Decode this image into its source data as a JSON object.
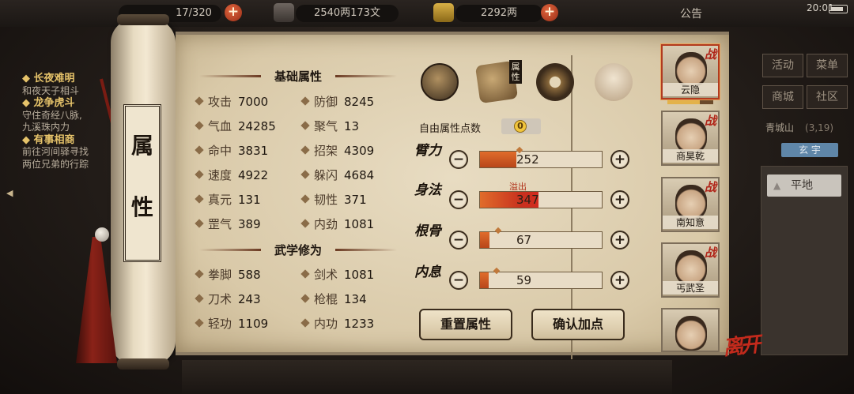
{
  "topbar": {
    "capacity": "17/320",
    "money": "2540两173文",
    "gold": "2292两",
    "announce": "公告",
    "clock": "20:01"
  },
  "quests": [
    {
      "title": "长夜难明",
      "desc": "和夜天子相斗"
    },
    {
      "title": "龙争虎斗",
      "desc": "守住奇经八脉,",
      "desc2": "九溪珠内力"
    },
    {
      "title": "有事相商",
      "desc": "前往河间驿寻找",
      "desc2": "两位兄弟的行踪"
    }
  ],
  "scroll_title": [
    "属",
    "性"
  ],
  "basic": {
    "title": "基础属性",
    "stats": [
      {
        "label": "攻击",
        "value": "7000"
      },
      {
        "label": "防御",
        "value": "8245"
      },
      {
        "label": "气血",
        "value": "24285"
      },
      {
        "label": "聚气",
        "value": "13"
      },
      {
        "label": "命中",
        "value": "3831"
      },
      {
        "label": "招架",
        "value": "4309"
      },
      {
        "label": "速度",
        "value": "4922"
      },
      {
        "label": "躲闪",
        "value": "4684"
      },
      {
        "label": "真元",
        "value": "131"
      },
      {
        "label": "韧性",
        "value": "371"
      },
      {
        "label": "罡气",
        "value": "389"
      },
      {
        "label": "内劲",
        "value": "1081"
      }
    ]
  },
  "martial": {
    "title": "武学修为",
    "stats": [
      {
        "label": "拳脚",
        "value": "588"
      },
      {
        "label": "剑术",
        "value": "1081"
      },
      {
        "label": "刀术",
        "value": "243"
      },
      {
        "label": "枪棍",
        "value": "134"
      },
      {
        "label": "轻功",
        "value": "1109"
      },
      {
        "label": "内功",
        "value": "1233"
      }
    ]
  },
  "tabs": {
    "active_label": "属性"
  },
  "free_points": {
    "label": "自由属性点数",
    "value": "0"
  },
  "attributes": [
    {
      "name": "臂力",
      "value": "252",
      "fill": 0.3
    },
    {
      "name": "身法",
      "value": "347",
      "fill": 0.48,
      "tag": "溢出"
    },
    {
      "name": "根骨",
      "value": "67",
      "fill": 0.08
    },
    {
      "name": "内息",
      "value": "59",
      "fill": 0.07
    }
  ],
  "buttons": {
    "reset": "重置属性",
    "confirm": "确认加点"
  },
  "characters": [
    {
      "name": "云隐",
      "badge": "战"
    },
    {
      "name": "商昊乾",
      "badge": "战"
    },
    {
      "name": "南知意",
      "badge": "战"
    },
    {
      "name": "丐武圣",
      "badge": "战"
    },
    {
      "name": "",
      "badge": ""
    }
  ],
  "leave_label": "离开",
  "right_menu": [
    "活动",
    "菜单",
    "商城",
    "社区"
  ],
  "location": {
    "name": "青城山",
    "coord": "(3,19)"
  },
  "terrain": {
    "tab": "玄 宇",
    "button": "平地"
  },
  "colors": {
    "accent": "#b23a1e",
    "bar_fill": "#d15a24",
    "parchment": "#e8dcc2"
  }
}
